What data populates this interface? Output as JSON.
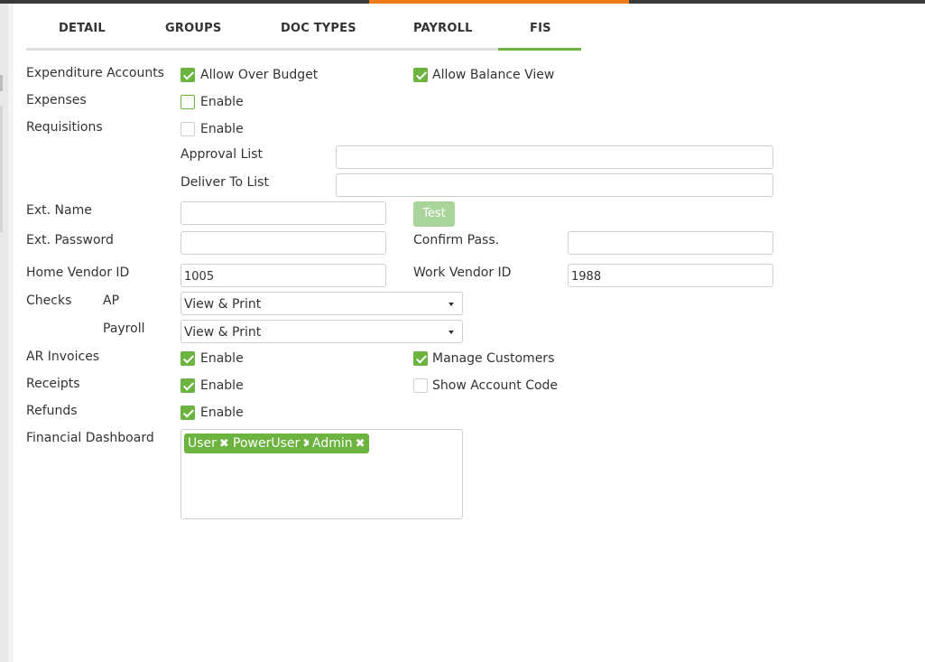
{
  "tabs": [
    {
      "label": "DETAIL"
    },
    {
      "label": "GROUPS"
    },
    {
      "label": "DOC TYPES"
    },
    {
      "label": "PAYROLL"
    },
    {
      "label": "FIS",
      "active": true
    }
  ],
  "accent_color": "#6cb33f",
  "top_accent_color": "#ee7b1a",
  "expenditure": {
    "label": "Expenditure Accounts",
    "allow_over_budget": {
      "label": "Allow Over Budget",
      "checked": true
    },
    "allow_balance_view": {
      "label": "Allow Balance View",
      "checked": true
    }
  },
  "expenses": {
    "label": "Expenses",
    "enable": {
      "label": "Enable",
      "checked": false
    }
  },
  "requisitions": {
    "label": "Requisitions",
    "enable": {
      "label": "Enable",
      "checked": false
    },
    "approval_list_label": "Approval List",
    "approval_list_value": "",
    "deliver_to_list_label": "Deliver To List",
    "deliver_to_list_value": ""
  },
  "ext_name": {
    "label": "Ext. Name",
    "value": "",
    "test_button": "Test"
  },
  "ext_password": {
    "label": "Ext. Password",
    "value": "",
    "confirm_label": "Confirm Pass.",
    "confirm_value": ""
  },
  "home_vendor": {
    "label": "Home Vendor ID",
    "value": "1005"
  },
  "work_vendor": {
    "label": "Work Vendor ID",
    "value": "1988"
  },
  "checks": {
    "label": "Checks",
    "ap_label": "AP",
    "ap_value": "View & Print",
    "payroll_label": "Payroll",
    "payroll_value": "View & Print"
  },
  "ar_invoices": {
    "label": "AR Invoices",
    "enable": {
      "label": "Enable",
      "checked": true
    },
    "manage_customers": {
      "label": "Manage Customers",
      "checked": true
    }
  },
  "receipts": {
    "label": "Receipts",
    "enable": {
      "label": "Enable",
      "checked": true
    },
    "show_account_code": {
      "label": "Show Account Code",
      "checked": false
    }
  },
  "refunds": {
    "label": "Refunds",
    "enable": {
      "label": "Enable",
      "checked": true
    }
  },
  "financial_dashboard": {
    "label": "Financial Dashboard",
    "tags": [
      "User",
      "PowerUser",
      "Admin"
    ],
    "remove_icon": "close-icon"
  }
}
